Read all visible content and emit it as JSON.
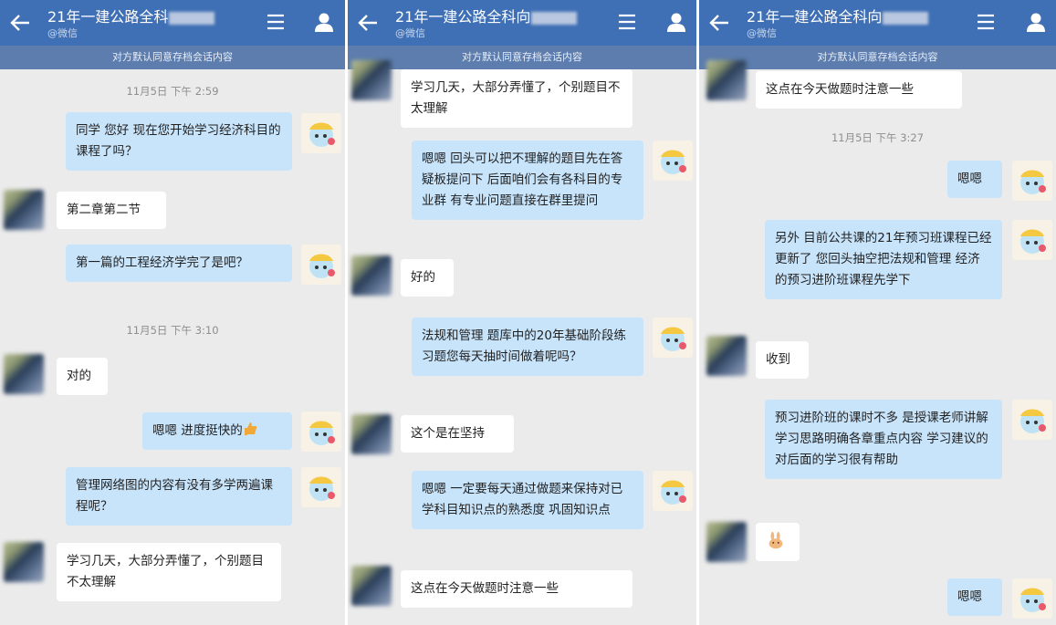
{
  "chat": {
    "title": "21年一建公路全科",
    "title2": "21年一建公路全科向",
    "subtitle": "@微信",
    "notice": "对方默认同意存档会话内容"
  },
  "colors": {
    "header": "#3f6fb4",
    "notice": "#5c7dad",
    "bg": "#ebebeb",
    "out_bubble": "#c8e4fb",
    "in_bubble": "#ffffff"
  },
  "icons": {
    "back": "arrow-left-icon",
    "menu": "menu-icon",
    "contact": "user-icon",
    "thumbs": "thumbs-up-emoji",
    "rabbit": "rabbit-emoji"
  },
  "panel1": {
    "t1": "11月5日  下午 2:59",
    "m1": "同学 您好 现在您开始学习经济科目的课程了吗？",
    "m2": "第二章第二节",
    "m3": "第一篇的工程经济学完了是吧？",
    "t2": "11月5日  下午 3:10",
    "m4": "对的",
    "m5": "嗯嗯 进度挺快的",
    "m6": "管理网络图的内容有没有多学两遍课程呢？",
    "m7": "学习几天，大部分弄懂了，个别题目不太理解"
  },
  "panel2": {
    "m1": "学习几天，大部分弄懂了，个别题目不太理解",
    "m2": "嗯嗯 回头可以把不理解的题目先在答疑板提问下 后面咱们会有各科目的专业群 有专业问题直接在群里提问",
    "m3": "好的",
    "m4": "法规和管理 题库中的20年基础阶段练习题您每天抽时间做着呢吗？",
    "m5": "这个是在坚持",
    "m6": "嗯嗯 一定要每天通过做题来保持对已学科目知识点的熟悉度 巩固知识点",
    "m7": "这点在今天做题时注意一些"
  },
  "panel3": {
    "m1": "这点在今天做题时注意一些",
    "t1": "11月5日  下午 3:27",
    "m2": "嗯嗯",
    "m3": "另外 目前公共课的21年预习班课程已经更新了 您回头抽空把法规和管理 经济的预习进阶班课程先学下",
    "m4": "收到",
    "m5": "预习进阶班的课时不多 是授课老师讲解学习思路明确各章重点内容 学习建议的 对后面的学习很有帮助",
    "m7": "嗯嗯"
  }
}
